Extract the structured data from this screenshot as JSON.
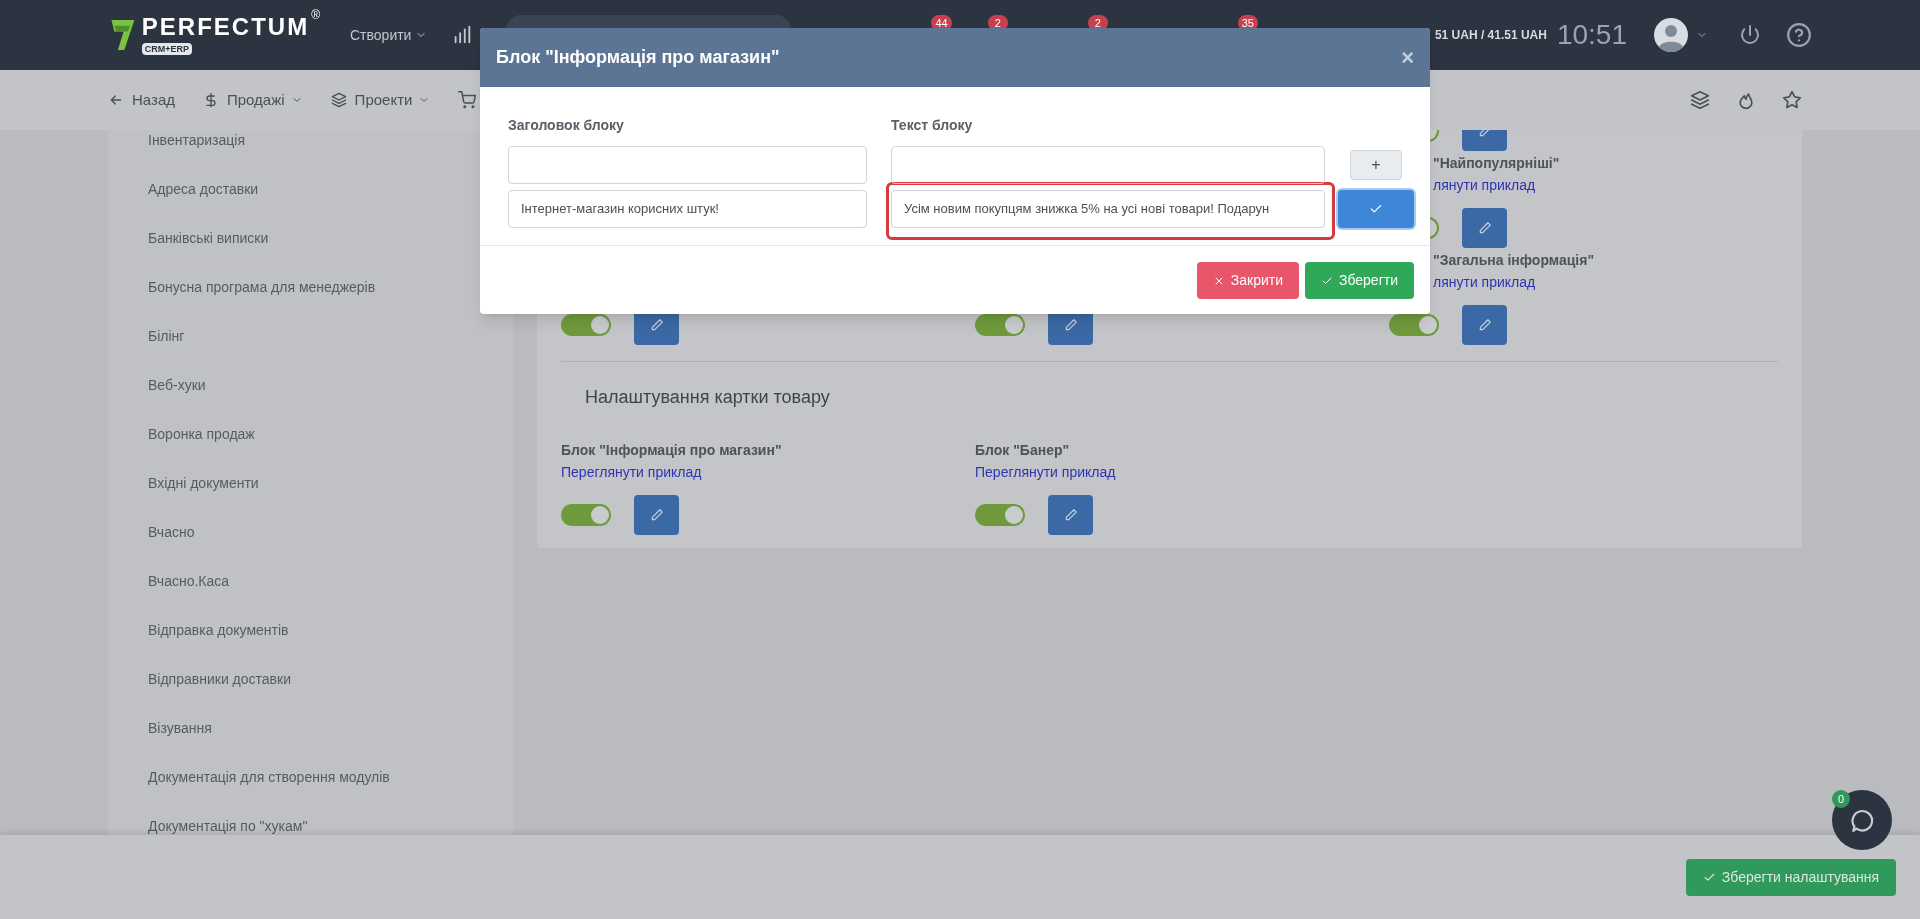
{
  "topbar": {
    "brand": "PERFECTUM",
    "brand_mark": "®",
    "brand_sub": "CRM+ERP",
    "create_menu": "Створити",
    "badges": [
      "44",
      "2",
      "2",
      "35"
    ],
    "balance": "51 UAH / 41.51 UAH",
    "time": "10:51"
  },
  "navbar": {
    "items": [
      {
        "kind": "back",
        "label": "Назад"
      },
      {
        "kind": "sales",
        "label": "Продажі"
      },
      {
        "kind": "projects",
        "label": "Проекти"
      }
    ]
  },
  "sidebar": {
    "items": [
      {
        "label": "Інвентаризація"
      },
      {
        "label": "Адреса доставки"
      },
      {
        "label": "Банківські виписки"
      },
      {
        "label": "Бонусна програма для менеджерів"
      },
      {
        "label": "Білінг"
      },
      {
        "label": "Веб-хуки"
      },
      {
        "label": "Воронка продаж"
      },
      {
        "label": "Вхідні документи"
      },
      {
        "label": "Вчасно"
      },
      {
        "label": "Вчасно.Каса"
      },
      {
        "label": "Відправка документів"
      },
      {
        "label": "Відправники доставки"
      },
      {
        "label": "Візування"
      },
      {
        "label": "Документація для створення модулів"
      },
      {
        "label": "Документація по \"хукам\""
      }
    ]
  },
  "store_blocks": {
    "columns": [
      [
        {
          "enabled": true
        }
      ],
      [
        {
          "enabled": true
        }
      ],
      [
        {
          "enabled": true
        },
        {
          "title": "\"Найпопулярніші\"",
          "link": "лянути приклад",
          "enabled": true
        },
        {
          "title": "\"Загальна інформація\"",
          "link": "лянути приклад",
          "enabled": true
        }
      ]
    ]
  },
  "product_card": {
    "heading": "Налаштування картки товару",
    "blocks": [
      {
        "title": "Блок \"Інформація про магазин\"",
        "link": "Переглянути приклад",
        "enabled": true
      },
      {
        "title": "Блок \"Банер\"",
        "link": "Переглянути приклад",
        "enabled": true
      }
    ]
  },
  "modal": {
    "title": "Блок \"Інформація про магазин\"",
    "close": "×",
    "columns": [
      "Заголовок блоку",
      "Текст блоку"
    ],
    "rows": [
      {
        "kind": "new",
        "action": "+",
        "highlighted": false
      },
      {
        "kind": "saved",
        "heading": "Інтернет-магазин корисних штук!",
        "text": "Усім новим покупцям знижка 5% на усі нові товари! Подарун",
        "highlighted": true
      }
    ],
    "buttons": [
      {
        "kind": "close",
        "label": "Закрити"
      },
      {
        "kind": "save",
        "label": "Зберегти"
      }
    ]
  },
  "footer": {
    "save_button": "Зберегти налаштування",
    "chat_badge": "0"
  }
}
